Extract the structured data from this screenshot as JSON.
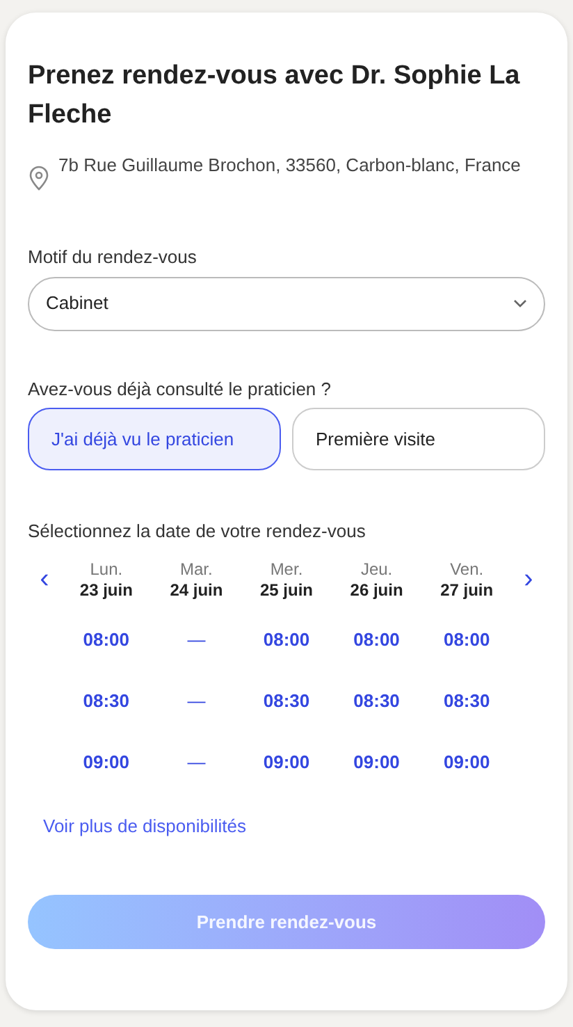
{
  "title": "Prenez rendez-vous avec Dr. Sophie La Fleche",
  "address": "7b Rue Guillaume Brochon, 33560, Carbon-blanc, France",
  "reason": {
    "label": "Motif du rendez-vous",
    "value": "Cabinet"
  },
  "visit": {
    "question": "Avez-vous déjà consulté le praticien ?",
    "options": [
      {
        "label": "J'ai déjà vu le praticien",
        "selected": true
      },
      {
        "label": "Première visite",
        "selected": false
      }
    ]
  },
  "calendar": {
    "label": "Sélectionnez la date de votre rendez-vous",
    "prev": "‹",
    "next": "›",
    "days": [
      {
        "weekday": "Lun.",
        "date": "23 juin",
        "slots": [
          {
            "kind": "time",
            "text": "08:00"
          },
          {
            "kind": "time",
            "text": "08:30"
          },
          {
            "kind": "time",
            "text": "09:00"
          }
        ]
      },
      {
        "weekday": "Mar.",
        "date": "24 juin",
        "slots": [
          {
            "kind": "none",
            "text": "—"
          },
          {
            "kind": "none",
            "text": "—"
          },
          {
            "kind": "none",
            "text": "—"
          }
        ]
      },
      {
        "weekday": "Mer.",
        "date": "25 juin",
        "slots": [
          {
            "kind": "time",
            "text": "08:00"
          },
          {
            "kind": "time",
            "text": "08:30"
          },
          {
            "kind": "time",
            "text": "09:00"
          }
        ]
      },
      {
        "weekday": "Jeu.",
        "date": "26 juin",
        "slots": [
          {
            "kind": "time",
            "text": "08:00"
          },
          {
            "kind": "time",
            "text": "08:30"
          },
          {
            "kind": "time",
            "text": "09:00"
          }
        ]
      },
      {
        "weekday": "Ven.",
        "date": "27 juin",
        "slots": [
          {
            "kind": "time",
            "text": "08:00"
          },
          {
            "kind": "time",
            "text": "08:30"
          },
          {
            "kind": "time",
            "text": "09:00"
          }
        ]
      }
    ],
    "more": "Voir plus de disponibilités"
  },
  "submit": {
    "label": "Prendre rendez-vous",
    "disabled": true
  }
}
